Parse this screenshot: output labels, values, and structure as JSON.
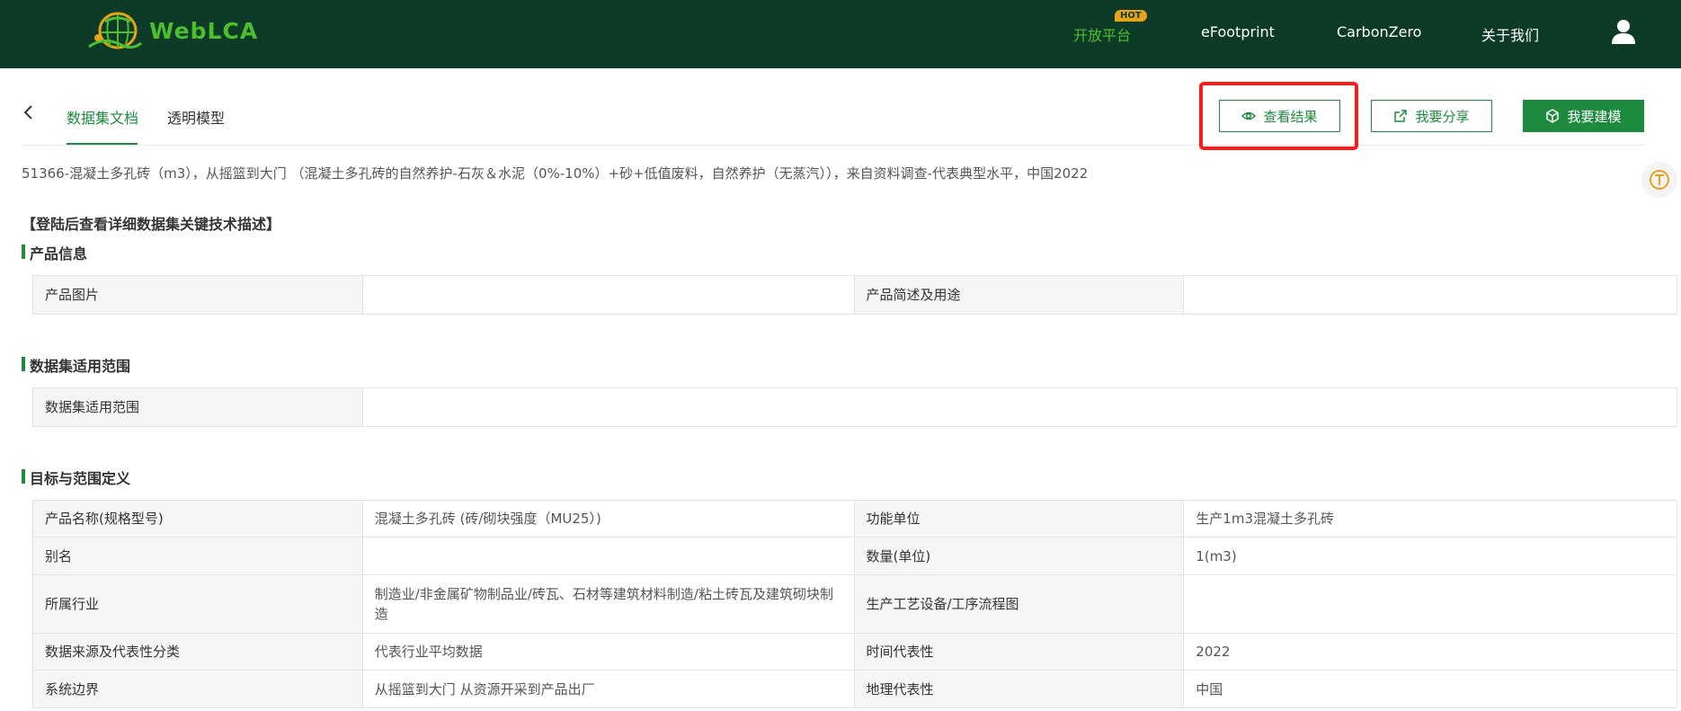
{
  "nav": {
    "logo_text": "WebLCA",
    "items": [
      "开放平台",
      "eFootprint",
      "CarbonZero",
      "关于我们"
    ],
    "hot_badge": "HOT"
  },
  "tabs": {
    "items": [
      "数据集文档",
      "透明模型"
    ]
  },
  "actions": {
    "view_results": "查看结果",
    "share": "我要分享",
    "model": "我要建模"
  },
  "dataset": {
    "title": "51366-混凝土多孔砖（m3），从摇篮到大门 （混凝土多孔砖的自然养护-石灰＆水泥（0%-10%）+砂+低值废料，自然养护（无蒸汽）），来自资料调查-代表典型水平，中国2022",
    "login_note": "【登陆后查看详细数据集关键技术描述】"
  },
  "sections": {
    "product_info": {
      "title": "产品信息",
      "rows": [
        {
          "label1": "产品图片",
          "value1": "",
          "label2": "产品简述及用途",
          "value2": ""
        }
      ]
    },
    "scope": {
      "title": "数据集适用范围",
      "label": "数据集适用范围",
      "value": ""
    },
    "goal": {
      "title": "目标与范围定义",
      "rows": [
        {
          "label1": "产品名称(规格型号)",
          "value1": "混凝土多孔砖 (砖/砌块强度（MU25）)",
          "label2": "功能单位",
          "value2": "生产1m3混凝土多孔砖"
        },
        {
          "label1": "别名",
          "value1": "",
          "label2": "数量(单位)",
          "value2": "1(m3)"
        },
        {
          "label1": "所属行业",
          "value1": "制造业/非金属矿物制品业/砖瓦、石材等建筑材料制造/粘土砖瓦及建筑砌块制造",
          "label2": "生产工艺设备/工序流程图",
          "value2": ""
        },
        {
          "label1": "数据来源及代表性分类",
          "value1": "代表行业平均数据",
          "label2": "时间代表性",
          "value2": "2022"
        },
        {
          "label1": "系统边界",
          "value1": "从摇篮到大门 从资源开采到产品出厂",
          "label2": "地理代表性",
          "value2": "中国"
        }
      ]
    }
  },
  "colors": {
    "nav_bg": "#0d3b27",
    "brand_green": "#1d8a3d",
    "logo_green": "#4cbf2f",
    "hot_badge": "#e8a317",
    "highlight_red": "#ff1a1a"
  }
}
